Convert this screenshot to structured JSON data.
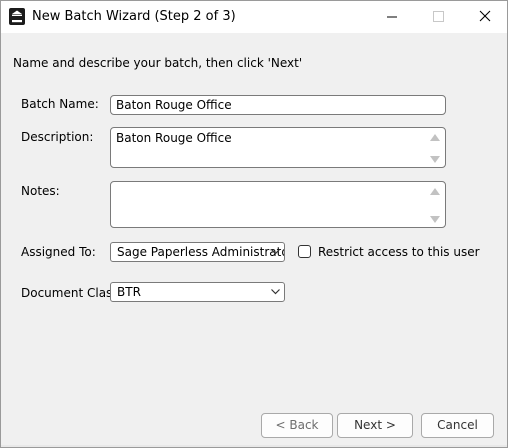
{
  "window": {
    "title": "New Batch Wizard (Step 2 of 3)",
    "app_icon": "sage-paperless-icon",
    "controls": [
      "minimize-icon",
      "maximize-icon",
      "close-icon"
    ]
  },
  "instructions": "Name and describe your batch, then click 'Next'",
  "fields": {
    "batch_name": {
      "label": "Batch Name:",
      "value": "Baton Rouge Office"
    },
    "description": {
      "label": "Description:",
      "value": "Baton Rouge Office"
    },
    "notes": {
      "label": "Notes:",
      "value": ""
    },
    "assigned_to": {
      "label": "Assigned To:",
      "value": "Sage Paperless  Administrator"
    },
    "restrict_access": {
      "label": "Restrict access to this user",
      "checked": false
    },
    "document_class": {
      "label": "Document Class:",
      "value": "BTR"
    }
  },
  "buttons": {
    "back": "< Back",
    "next": "Next >",
    "cancel": "Cancel"
  },
  "colors": {
    "dialog_background": "#f0f0f0",
    "titlebar_background": "#ffffff",
    "field_border": "#7a7a7a",
    "disabled_text": "#6d6d6d"
  }
}
